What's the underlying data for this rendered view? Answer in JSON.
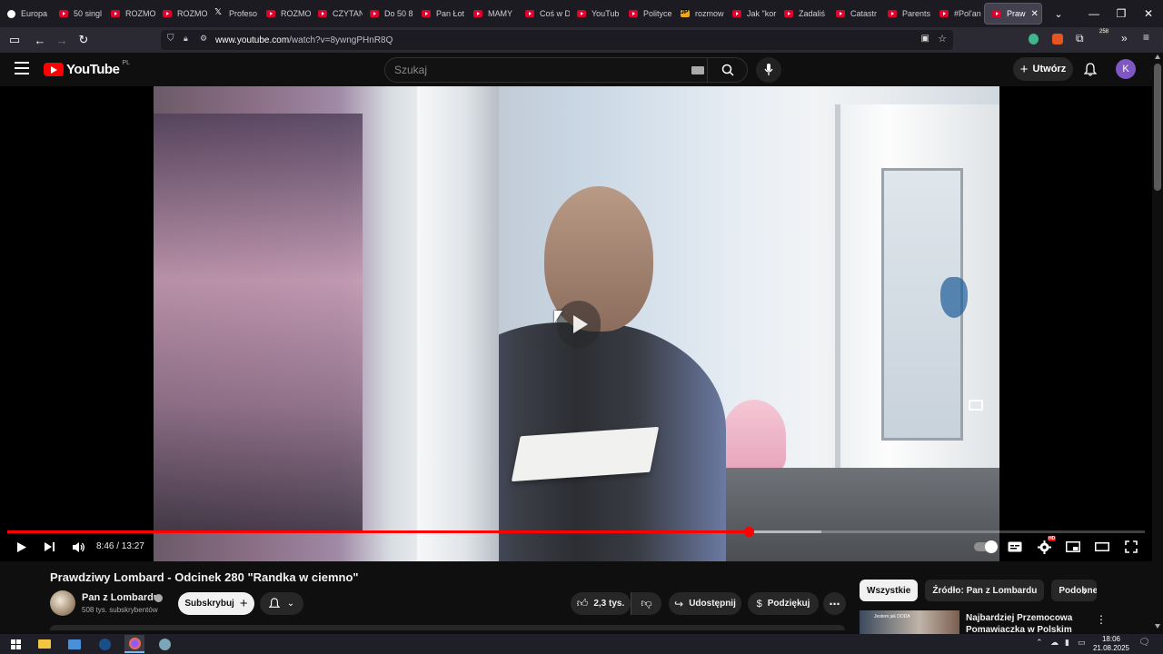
{
  "browser": {
    "tabs": [
      {
        "label": "Europa",
        "favicon": "globe-icon"
      },
      {
        "label": "50 singl",
        "favicon": "youtube-icon"
      },
      {
        "label": "ROZMO",
        "favicon": "youtube-icon"
      },
      {
        "label": "ROZMO",
        "favicon": "youtube-icon"
      },
      {
        "label": "Profeso",
        "favicon": "x-icon"
      },
      {
        "label": "ROZMO",
        "favicon": "youtube-icon"
      },
      {
        "label": "CZYTAN",
        "favicon": "youtube-icon"
      },
      {
        "label": "Do 50 8",
        "favicon": "youtube-icon"
      },
      {
        "label": "Pan Łot",
        "favicon": "youtube-icon"
      },
      {
        "label": "MAMY",
        "favicon": "youtube-icon"
      },
      {
        "label": "Coś w D",
        "favicon": "youtube-icon"
      },
      {
        "label": "YouTub",
        "favicon": "youtube-icon"
      },
      {
        "label": "Polityce",
        "favicon": "youtube-icon"
      },
      {
        "label": "rozmow",
        "favicon": "jp-icon"
      },
      {
        "label": "Jak \"kor",
        "favicon": "youtube-icon"
      },
      {
        "label": "Zadaliś",
        "favicon": "youtube-icon"
      },
      {
        "label": "Catastr",
        "favicon": "youtube-icon"
      },
      {
        "label": "Parents",
        "favicon": "youtube-icon"
      },
      {
        "label": "#Pol'an",
        "favicon": "youtube-icon"
      }
    ],
    "active_tab": {
      "label": "Praw",
      "favicon": "youtube-icon"
    },
    "url_host": "www.youtube.com",
    "url_path": "/watch?v=8ywngPHnR8Q",
    "extension_badge": "258"
  },
  "youtube": {
    "logo_text": "YouTube",
    "country_code": "PL",
    "search_placeholder": "Szukaj",
    "create_label": "Utwórz",
    "avatar_letter": "K"
  },
  "player": {
    "current_time": "8:46",
    "duration": "13:27",
    "time_display": "8:46 / 13:27",
    "played_fraction": 0.652,
    "buffered_fraction": 0.716,
    "hd_badge": "HD"
  },
  "video": {
    "title": "Prawdziwy Lombard - Odcinek 280 \"Randka w ciemno\"",
    "channel_name": "Pan z Lombardu",
    "subscribers": "508 tys. subskrybentów",
    "subscribe_label": "Subskrybuj",
    "likes": "2,3 tys.",
    "share_label": "Udostępnij",
    "thanks_label": "Podziękuj"
  },
  "sidebar": {
    "chips": [
      "Wszystkie",
      "Źródło: Pan z Lombardu",
      "Podobne"
    ],
    "recommendation": {
      "title": "Najbardziej Przemocowa Pomawiaczka w Polskim",
      "thumb_text": "Jestem jak DODA"
    }
  },
  "taskbar": {
    "time": "18:06",
    "date": "21.08.2025"
  },
  "colors": {
    "accent": "#ff0000",
    "page_bg": "#0f0f0f",
    "tab_bar": "#1c1b22",
    "nav_bar": "#2b2a33"
  }
}
